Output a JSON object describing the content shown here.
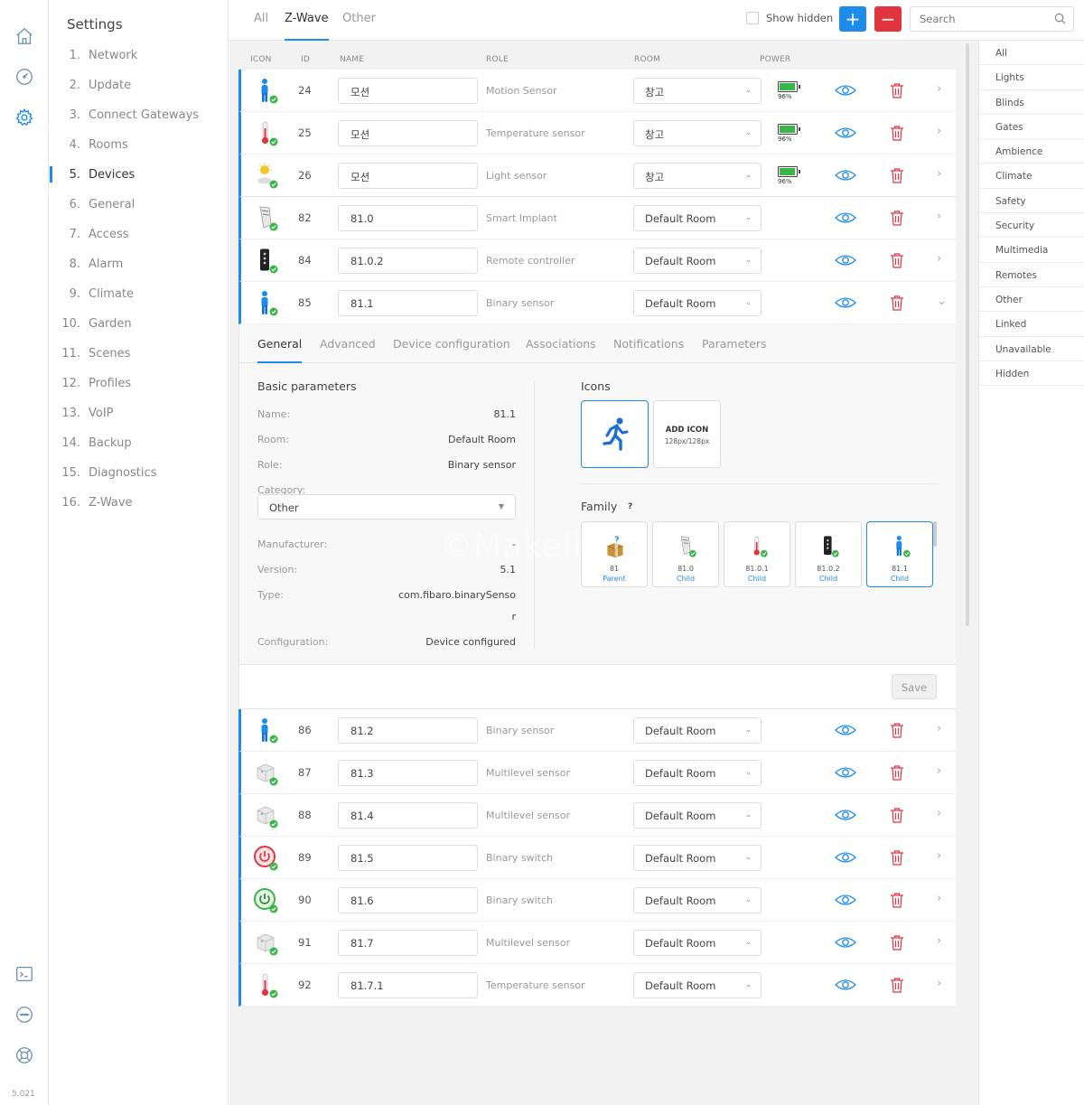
{
  "app": {
    "version": "5.021"
  },
  "rail": {
    "icons": [
      "home-icon",
      "dashboard-gauge-icon",
      "settings-gear-icon",
      "terminal-icon",
      "network-icon",
      "lifebuoy-icon"
    ]
  },
  "menu": {
    "title": "Settings",
    "items": [
      {
        "num": "1.",
        "label": "Network"
      },
      {
        "num": "2.",
        "label": "Update"
      },
      {
        "num": "3.",
        "label": "Connect Gateways"
      },
      {
        "num": "4.",
        "label": "Rooms"
      },
      {
        "num": "5.",
        "label": "Devices"
      },
      {
        "num": "6.",
        "label": "General"
      },
      {
        "num": "7.",
        "label": "Access"
      },
      {
        "num": "8.",
        "label": "Alarm"
      },
      {
        "num": "9.",
        "label": "Climate"
      },
      {
        "num": "10.",
        "label": "Garden"
      },
      {
        "num": "11.",
        "label": "Scenes"
      },
      {
        "num": "12.",
        "label": "Profiles"
      },
      {
        "num": "13.",
        "label": "VoIP"
      },
      {
        "num": "14.",
        "label": "Backup"
      },
      {
        "num": "15.",
        "label": "Diagnostics"
      },
      {
        "num": "16.",
        "label": "Z-Wave"
      }
    ]
  },
  "topbar": {
    "tabs": [
      "All",
      "Z-Wave",
      "Other"
    ],
    "show_hidden": "Show hidden",
    "add": "+",
    "remove": "−",
    "search_placeholder": "Search"
  },
  "columns": {
    "icon": "ICON",
    "id": "ID",
    "name": "NAME",
    "role": "ROLE",
    "room": "ROOM",
    "power": "POWER"
  },
  "devices_top": [
    {
      "icon": "person-motion-icon",
      "id": "24",
      "name": "모션",
      "role": "Motion Sensor",
      "room": "창고",
      "battery": "96%",
      "battery_level": 0.96,
      "arrow": "›"
    },
    {
      "icon": "thermometer-icon",
      "id": "25",
      "name": "모션",
      "role": "Temperature sensor",
      "room": "창고",
      "battery": "96%",
      "battery_level": 0.96,
      "arrow": "›"
    },
    {
      "icon": "sun-light-icon",
      "id": "26",
      "name": "모션",
      "role": "Light sensor",
      "room": "창고",
      "battery": "96%",
      "battery_level": 0.96,
      "arrow": "›"
    },
    {
      "icon": "smart-implant-icon",
      "id": "82",
      "name": "81.0",
      "role": "Smart Implant",
      "room": "Default Room",
      "arrow": "›"
    },
    {
      "icon": "remote-controller-icon",
      "id": "84",
      "name": "81.0.2",
      "role": "Remote controller",
      "room": "Default Room",
      "arrow": "›"
    },
    {
      "icon": "person-motion-icon",
      "id": "85",
      "name": "81.1",
      "role": "Binary sensor",
      "room": "Default Room",
      "arrow": "⌄"
    }
  ],
  "details": {
    "tabs": [
      "General",
      "Advanced",
      "Device configuration",
      "Associations",
      "Notifications",
      "Parameters"
    ],
    "basic_title": "Basic parameters",
    "name_label": "Name:",
    "name_value": "81.1",
    "room_label": "Room:",
    "room_value": "Default Room",
    "role_label": "Role:",
    "role_value": "Binary sensor",
    "category_label": "Category:",
    "category_value": "Other",
    "manufacturer_label": "Manufacturer:",
    "manufacturer_value": "-",
    "version_label": "Version:",
    "version_value": "5.1",
    "type_label": "Type:",
    "type_value_1": "com.fibaro.binarySenso",
    "type_value_2": "r",
    "configuration_label": "Configuration:",
    "configuration_value": "Device configured",
    "icons_title": "Icons",
    "add_icon": "ADD ICON",
    "add_icon_size": "128px/128px",
    "family_title": "Family",
    "family_help": "?",
    "family": [
      {
        "icon": "package-question-icon",
        "name": "81",
        "relation": "Parent"
      },
      {
        "icon": "smart-implant-icon",
        "name": "81.0",
        "relation": "Child"
      },
      {
        "icon": "thermometer-icon",
        "name": "81.0.1",
        "relation": "Child"
      },
      {
        "icon": "remote-controller-icon",
        "name": "81.0.2",
        "relation": "Child"
      },
      {
        "icon": "person-motion-icon",
        "name": "81.1",
        "relation": "Child"
      }
    ],
    "watermark": "©Makelism",
    "save": "Save"
  },
  "devices_bottom": [
    {
      "icon": "person-motion-icon",
      "id": "86",
      "name": "81.2",
      "role": "Binary sensor",
      "room": "Default Room",
      "arrow": "›"
    },
    {
      "icon": "multilevel-cube-icon",
      "id": "87",
      "name": "81.3",
      "role": "Multilevel sensor",
      "room": "Default Room",
      "arrow": "›"
    },
    {
      "icon": "multilevel-cube-icon",
      "id": "88",
      "name": "81.4",
      "role": "Multilevel sensor",
      "room": "Default Room",
      "arrow": "›"
    },
    {
      "icon": "power-switch-red-icon",
      "id": "89",
      "name": "81.5",
      "role": "Binary switch",
      "room": "Default Room",
      "arrow": "›"
    },
    {
      "icon": "power-switch-green-icon",
      "id": "90",
      "name": "81.6",
      "role": "Binary switch",
      "room": "Default Room",
      "arrow": "›"
    },
    {
      "icon": "multilevel-cube-icon",
      "id": "91",
      "name": "81.7",
      "role": "Multilevel sensor",
      "room": "Default Room",
      "arrow": "›"
    },
    {
      "icon": "thermometer-icon",
      "id": "92",
      "name": "81.7.1",
      "role": "Temperature sensor",
      "room": "Default Room",
      "arrow": "›"
    }
  ],
  "categories": [
    "All",
    "Lights",
    "Blinds",
    "Gates",
    "Ambience",
    "Climate",
    "Safety",
    "Security",
    "Multimedia",
    "Remotes",
    "Other",
    "Linked",
    "Unavailable",
    "Hidden"
  ],
  "colors": {
    "accent": "#1d8bea",
    "danger": "#e0343f",
    "ok": "#39b54a"
  }
}
